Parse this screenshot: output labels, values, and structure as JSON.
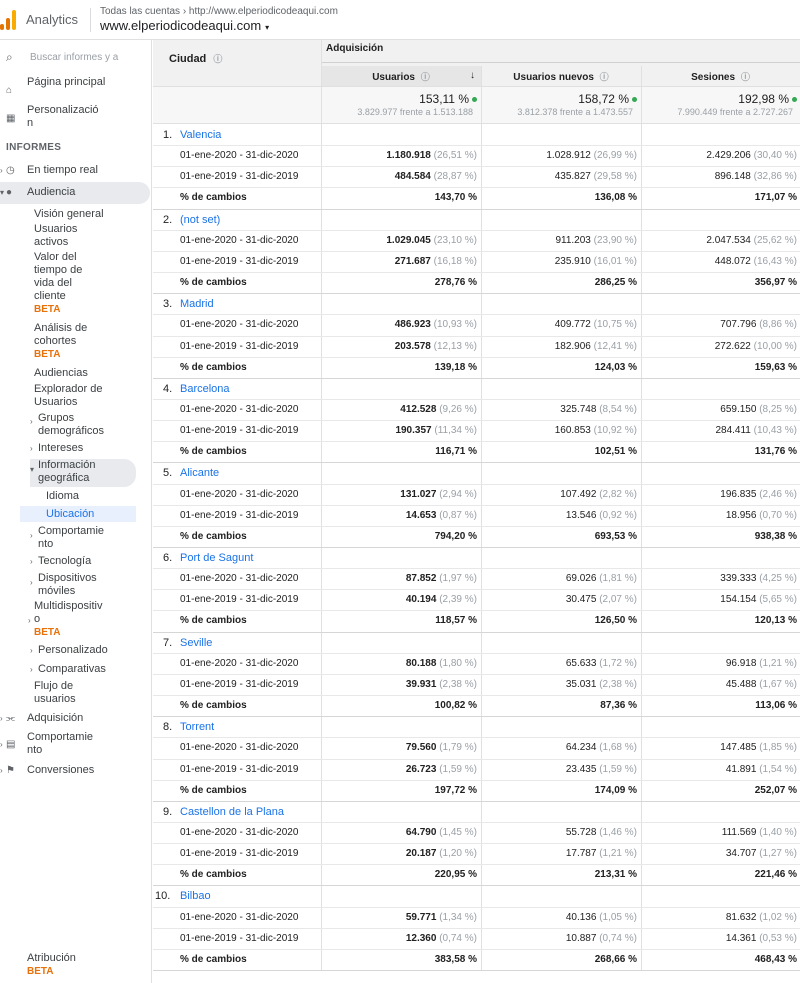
{
  "header": {
    "app_name": "Analytics",
    "account_path": "Todas las cuentas › http://www.elperiodicodeaqui.com",
    "property": "www.elperiodicodeaqui.com",
    "caret": "▾",
    "logo_colors": [
      "#f9ab00",
      "#e37400",
      "#e37400"
    ]
  },
  "sidebar": {
    "search_placeholder": "Buscar informes y a",
    "home_label": "Página principal",
    "custom_label": "Personalización",
    "reports_heading": "INFORMES",
    "realtime_label": "En tiempo real",
    "audience_label": "Audiencia",
    "audience_items": {
      "overview": "Visión general",
      "active_users": "Usuarios activos",
      "ltv": "Valor del tiempo de vida del cliente",
      "ltv_badge": "BETA",
      "cohort": "Análisis de cohortes",
      "cohort_badge": "BETA",
      "audiences": "Audiencias",
      "user_explorer": "Explorador de Usuarios",
      "demographics": "Grupos demográficos",
      "interests": "Intereses",
      "geo": "Información geográfica",
      "language": "Idioma",
      "location": "Ubicación",
      "behavior": "Comportamiento",
      "technology": "Tecnología",
      "mobile": "Dispositivos móviles",
      "crossdevice": "Multidispositivo",
      "crossdevice_badge": "BETA",
      "custom": "Personalizado",
      "benchmarking": "Comparativas",
      "users_flow": "Flujo de usuarios"
    },
    "acquisition_label": "Adquisición",
    "behavior_label": "Comportamiento",
    "conversions_label": "Conversiones",
    "attribution_label": "Atribución",
    "attribution_badge": "BETA"
  },
  "table": {
    "dimension_header": "Ciudad",
    "group_header": "Adquisición",
    "columns": [
      "Usuarios",
      "Usuarios nuevos",
      "Sesiones"
    ],
    "sort_arrow": "↓",
    "totals": [
      {
        "pct": "153,11 %",
        "sub": "3.829.977 frente a 1.513.188"
      },
      {
        "pct": "158,72 %",
        "sub": "3.812.378 frente a 1.473.557"
      },
      {
        "pct": "192,98 %",
        "sub": "7.990.449 frente a 2.727.267"
      }
    ],
    "change_label": "% de cambios",
    "range_current": "01-ene-2020 - 31-dic-2020",
    "range_previous": "01-ene-2019 - 31-dic-2019",
    "rows": [
      {
        "idx": "1.",
        "city": "Valencia",
        "cur": [
          [
            "1.180.918",
            "(26,51 %)"
          ],
          [
            "1.028.912",
            "(26,99 %)"
          ],
          [
            "2.429.206",
            "(30,40 %)"
          ]
        ],
        "prev": [
          [
            "484.584",
            "(28,87 %)"
          ],
          [
            "435.827",
            "(29,58 %)"
          ],
          [
            "896.148",
            "(32,86 %)"
          ]
        ],
        "chg": [
          "143,70 %",
          "136,08 %",
          "171,07 %"
        ]
      },
      {
        "idx": "2.",
        "city": "(not set)",
        "cur": [
          [
            "1.029.045",
            "(23,10 %)"
          ],
          [
            "911.203",
            "(23,90 %)"
          ],
          [
            "2.047.534",
            "(25,62 %)"
          ]
        ],
        "prev": [
          [
            "271.687",
            "(16,18 %)"
          ],
          [
            "235.910",
            "(16,01 %)"
          ],
          [
            "448.072",
            "(16,43 %)"
          ]
        ],
        "chg": [
          "278,76 %",
          "286,25 %",
          "356,97 %"
        ]
      },
      {
        "idx": "3.",
        "city": "Madrid",
        "cur": [
          [
            "486.923",
            "(10,93 %)"
          ],
          [
            "409.772",
            "(10,75 %)"
          ],
          [
            "707.796",
            "(8,86 %)"
          ]
        ],
        "prev": [
          [
            "203.578",
            "(12,13 %)"
          ],
          [
            "182.906",
            "(12,41 %)"
          ],
          [
            "272.622",
            "(10,00 %)"
          ]
        ],
        "chg": [
          "139,18 %",
          "124,03 %",
          "159,63 %"
        ]
      },
      {
        "idx": "4.",
        "city": "Barcelona",
        "cur": [
          [
            "412.528",
            "(9,26 %)"
          ],
          [
            "325.748",
            "(8,54 %)"
          ],
          [
            "659.150",
            "(8,25 %)"
          ]
        ],
        "prev": [
          [
            "190.357",
            "(11,34 %)"
          ],
          [
            "160.853",
            "(10,92 %)"
          ],
          [
            "284.411",
            "(10,43 %)"
          ]
        ],
        "chg": [
          "116,71 %",
          "102,51 %",
          "131,76 %"
        ]
      },
      {
        "idx": "5.",
        "city": "Alicante",
        "cur": [
          [
            "131.027",
            "(2,94 %)"
          ],
          [
            "107.492",
            "(2,82 %)"
          ],
          [
            "196.835",
            "(2,46 %)"
          ]
        ],
        "prev": [
          [
            "14.653",
            "(0,87 %)"
          ],
          [
            "13.546",
            "(0,92 %)"
          ],
          [
            "18.956",
            "(0,70 %)"
          ]
        ],
        "chg": [
          "794,20 %",
          "693,53 %",
          "938,38 %"
        ]
      },
      {
        "idx": "6.",
        "city": "Port de Sagunt",
        "cur": [
          [
            "87.852",
            "(1,97 %)"
          ],
          [
            "69.026",
            "(1,81 %)"
          ],
          [
            "339.333",
            "(4,25 %)"
          ]
        ],
        "prev": [
          [
            "40.194",
            "(2,39 %)"
          ],
          [
            "30.475",
            "(2,07 %)"
          ],
          [
            "154.154",
            "(5,65 %)"
          ]
        ],
        "chg": [
          "118,57 %",
          "126,50 %",
          "120,13 %"
        ]
      },
      {
        "idx": "7.",
        "city": "Seville",
        "cur": [
          [
            "80.188",
            "(1,80 %)"
          ],
          [
            "65.633",
            "(1,72 %)"
          ],
          [
            "96.918",
            "(1,21 %)"
          ]
        ],
        "prev": [
          [
            "39.931",
            "(2,38 %)"
          ],
          [
            "35.031",
            "(2,38 %)"
          ],
          [
            "45.488",
            "(1,67 %)"
          ]
        ],
        "chg": [
          "100,82 %",
          "87,36 %",
          "113,06 %"
        ]
      },
      {
        "idx": "8.",
        "city": "Torrent",
        "cur": [
          [
            "79.560",
            "(1,79 %)"
          ],
          [
            "64.234",
            "(1,68 %)"
          ],
          [
            "147.485",
            "(1,85 %)"
          ]
        ],
        "prev": [
          [
            "26.723",
            "(1,59 %)"
          ],
          [
            "23.435",
            "(1,59 %)"
          ],
          [
            "41.891",
            "(1,54 %)"
          ]
        ],
        "chg": [
          "197,72 %",
          "174,09 %",
          "252,07 %"
        ]
      },
      {
        "idx": "9.",
        "city": "Castellon de la Plana",
        "cur": [
          [
            "64.790",
            "(1,45 %)"
          ],
          [
            "55.728",
            "(1,46 %)"
          ],
          [
            "111.569",
            "(1,40 %)"
          ]
        ],
        "prev": [
          [
            "20.187",
            "(1,20 %)"
          ],
          [
            "17.787",
            "(1,21 %)"
          ],
          [
            "34.707",
            "(1,27 %)"
          ]
        ],
        "chg": [
          "220,95 %",
          "213,31 %",
          "221,46 %"
        ]
      },
      {
        "idx": "10.",
        "city": "Bilbao",
        "cur": [
          [
            "59.771",
            "(1,34 %)"
          ],
          [
            "40.136",
            "(1,05 %)"
          ],
          [
            "81.632",
            "(1,02 %)"
          ]
        ],
        "prev": [
          [
            "12.360",
            "(0,74 %)"
          ],
          [
            "10.887",
            "(0,74 %)"
          ],
          [
            "14.361",
            "(0,53 %)"
          ]
        ],
        "chg": [
          "383,58 %",
          "268,66 %",
          "468,43 %"
        ]
      }
    ]
  },
  "colors": {
    "link": "#1a73e8",
    "positive": "#34a853",
    "beta": "#e8710a"
  }
}
